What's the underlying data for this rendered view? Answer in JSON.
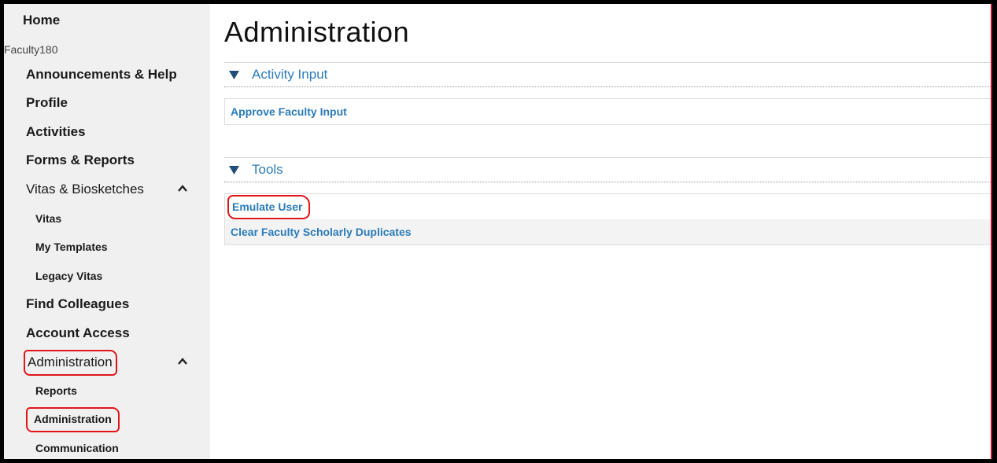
{
  "sidebar": {
    "home": "Home",
    "brand": "Faculty180",
    "items": {
      "announcements": "Announcements & Help",
      "profile": "Profile",
      "activities": "Activities",
      "forms_reports": "Forms & Reports",
      "vitas_biosketches": "Vitas & Biosketches",
      "vitas": "Vitas",
      "my_templates": "My Templates",
      "legacy_vitas": "Legacy Vitas",
      "find_colleagues": "Find Colleagues",
      "account_access": "Account Access",
      "administration": "Administration",
      "reports": "Reports",
      "administration_sub": "Administration",
      "communication": "Communication"
    }
  },
  "main": {
    "title": "Administration",
    "sections": {
      "activity_input": {
        "title": "Activity Input",
        "links": [
          "Approve Faculty Input"
        ]
      },
      "tools": {
        "title": "Tools",
        "links": [
          "Emulate User",
          "Clear Faculty Scholarly Duplicates"
        ]
      }
    }
  },
  "colors": {
    "link": "#2b7bb9",
    "sidebar_bg": "#f0f0f0",
    "annotation": "#e0161b"
  },
  "icons": {
    "expanded_section": "caret-up-icon",
    "section_toggle": "triangle-down-icon"
  }
}
